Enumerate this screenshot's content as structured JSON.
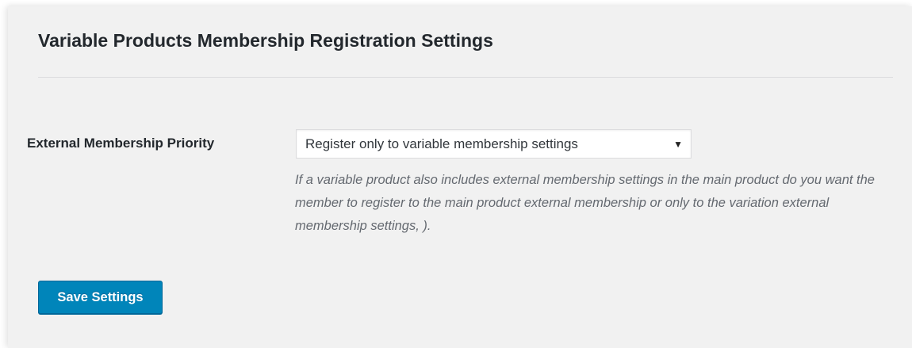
{
  "header": {
    "title": "Variable Products Membership Registration Settings"
  },
  "form": {
    "external_priority": {
      "label": "External Membership Priority",
      "selected_value": "Register only to variable membership settings",
      "arrow_glyph": "▼",
      "description": "If a variable product also includes external membership settings in the main product do you want the member to register to the main product external membership or only to the variation external membership settings, )."
    }
  },
  "actions": {
    "save_label": "Save Settings"
  },
  "colors": {
    "panel_background": "#f1f1f1",
    "primary_button": "#0085ba",
    "primary_button_border": "#006799",
    "text_dark": "#23282d",
    "description_text": "#646970"
  }
}
